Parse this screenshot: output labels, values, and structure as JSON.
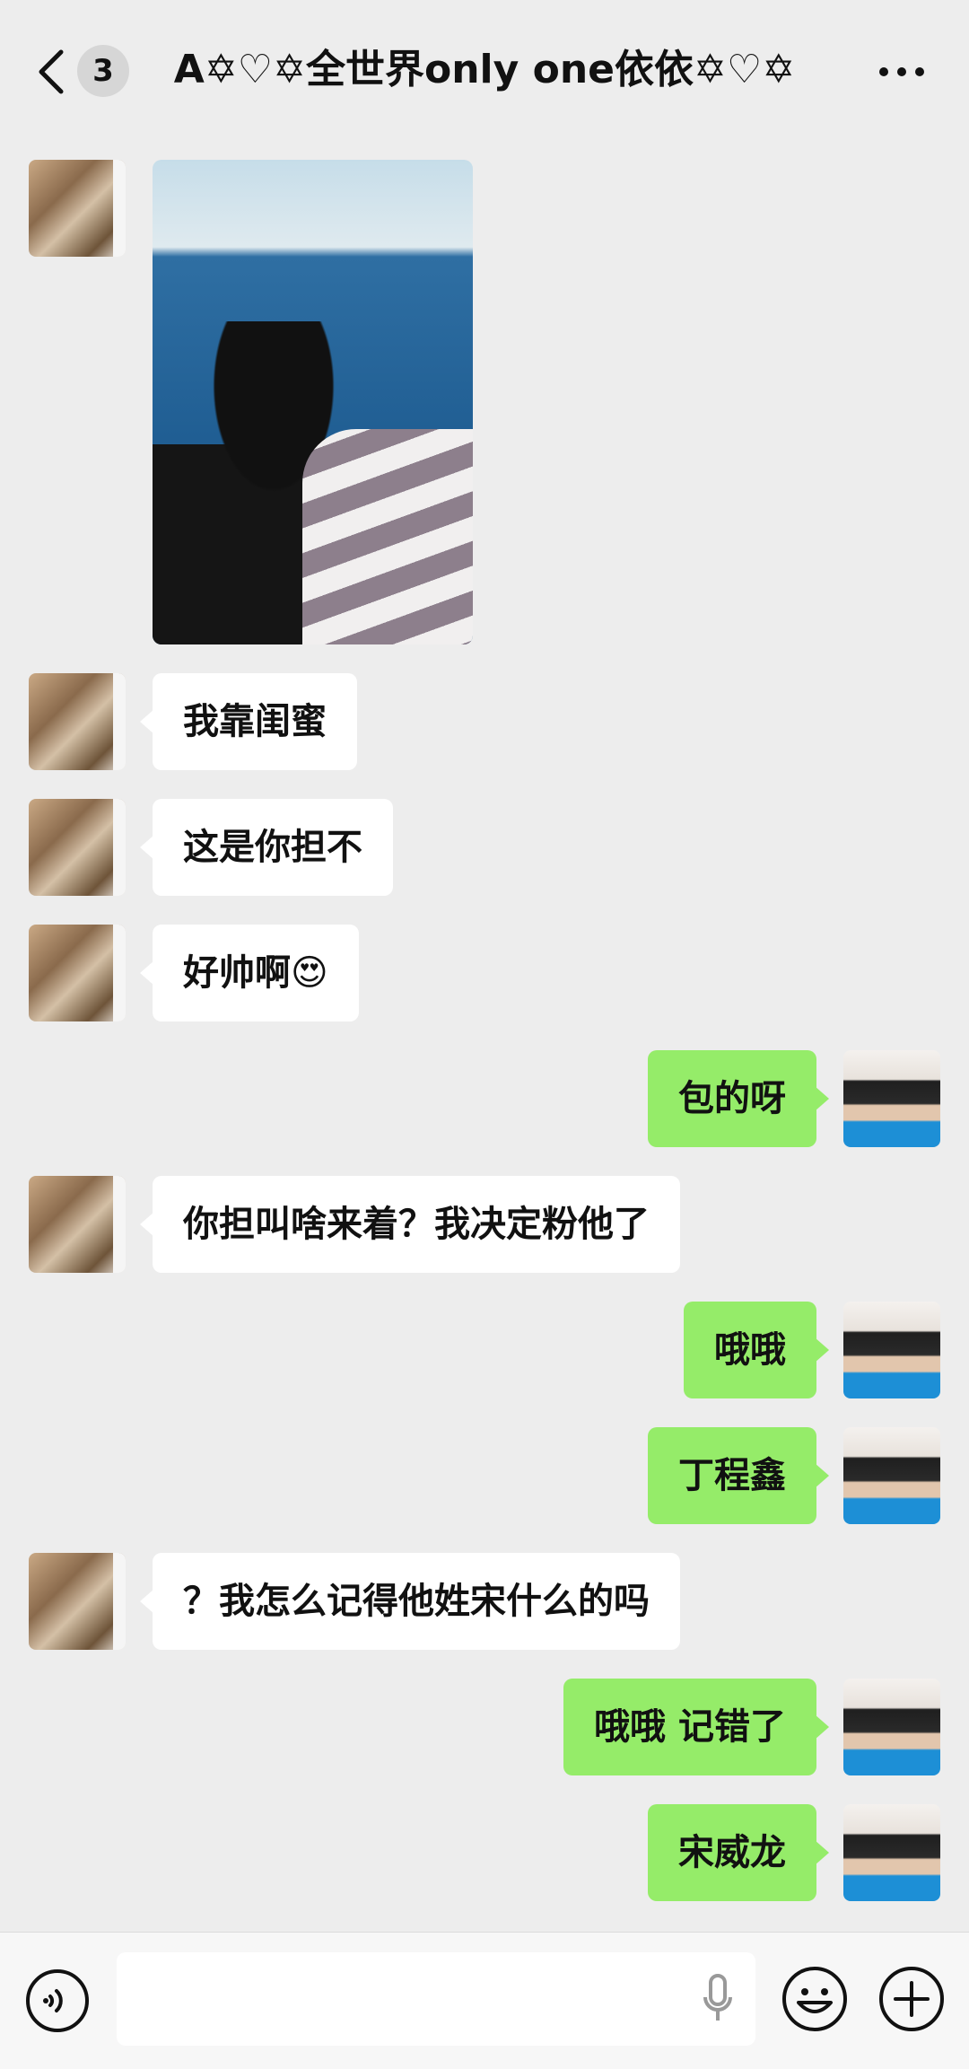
{
  "header": {
    "unread_count": "3",
    "title": "A✡♡✡全世界only one依依✡♡✡"
  },
  "messages": [
    {
      "side": "left",
      "type": "image"
    },
    {
      "side": "left",
      "text": "我靠闺蜜"
    },
    {
      "side": "left",
      "text": "这是你担不"
    },
    {
      "side": "left",
      "text": "好帅啊😍"
    },
    {
      "side": "right",
      "text": "包的呀"
    },
    {
      "side": "left",
      "text": "你担叫啥来着？我决定粉他了"
    },
    {
      "side": "right",
      "text": "哦哦"
    },
    {
      "side": "right",
      "text": "丁程鑫"
    },
    {
      "side": "left",
      "text": "？我怎么记得他姓宋什么的吗"
    },
    {
      "side": "right",
      "text": "哦哦 记错了"
    },
    {
      "side": "right",
      "text": "宋威龙"
    }
  ],
  "footer": {
    "input_value": ""
  },
  "colors": {
    "background": "#ededed",
    "bubble_self": "#95ec69",
    "bubble_other": "#ffffff"
  }
}
